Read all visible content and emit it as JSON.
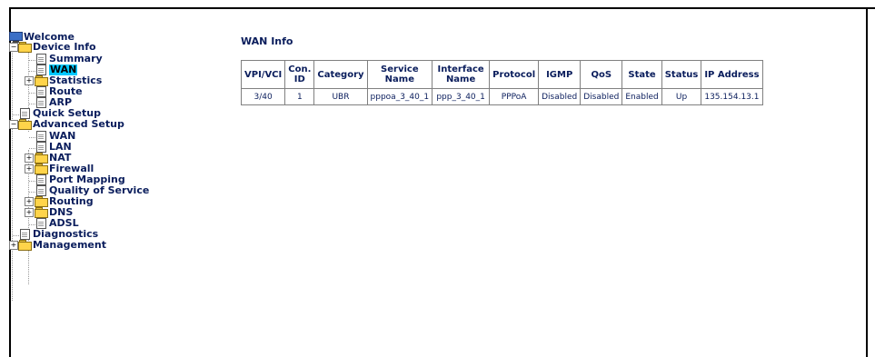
{
  "nav": {
    "welcome": "Welcome",
    "device_info": "Device Info",
    "summary": "Summary",
    "wan": "WAN",
    "statistics": "Statistics",
    "route": "Route",
    "arp": "ARP",
    "quick_setup": "Quick Setup",
    "advanced_setup": "Advanced Setup",
    "adv_wan": "WAN",
    "lan": "LAN",
    "nat": "NAT",
    "firewall": "Firewall",
    "port_mapping": "Port Mapping",
    "qos": "Quality of Service",
    "routing": "Routing",
    "dns": "DNS",
    "adsl": "ADSL",
    "diagnostics": "Diagnostics",
    "management": "Management",
    "expand_glyph": "+",
    "collapse_glyph": "−"
  },
  "main": {
    "title": "WAN Info",
    "headers": [
      "VPI/VCI",
      "Con. ID",
      "Category",
      "Service Name",
      "Interface Name",
      "Protocol",
      "IGMP",
      "QoS",
      "State",
      "Status",
      "IP Address"
    ],
    "rows": [
      [
        "3/40",
        "1",
        "UBR",
        "pppoa_3_40_1",
        "ppp_3_40_1",
        "PPPoA",
        "Disabled",
        "Disabled",
        "Enabled",
        "Up",
        "135.154.13.1"
      ]
    ]
  },
  "colors": {
    "link": "#0a1d5c",
    "selected": "#00c8ff",
    "folder": "#ffd44a"
  }
}
